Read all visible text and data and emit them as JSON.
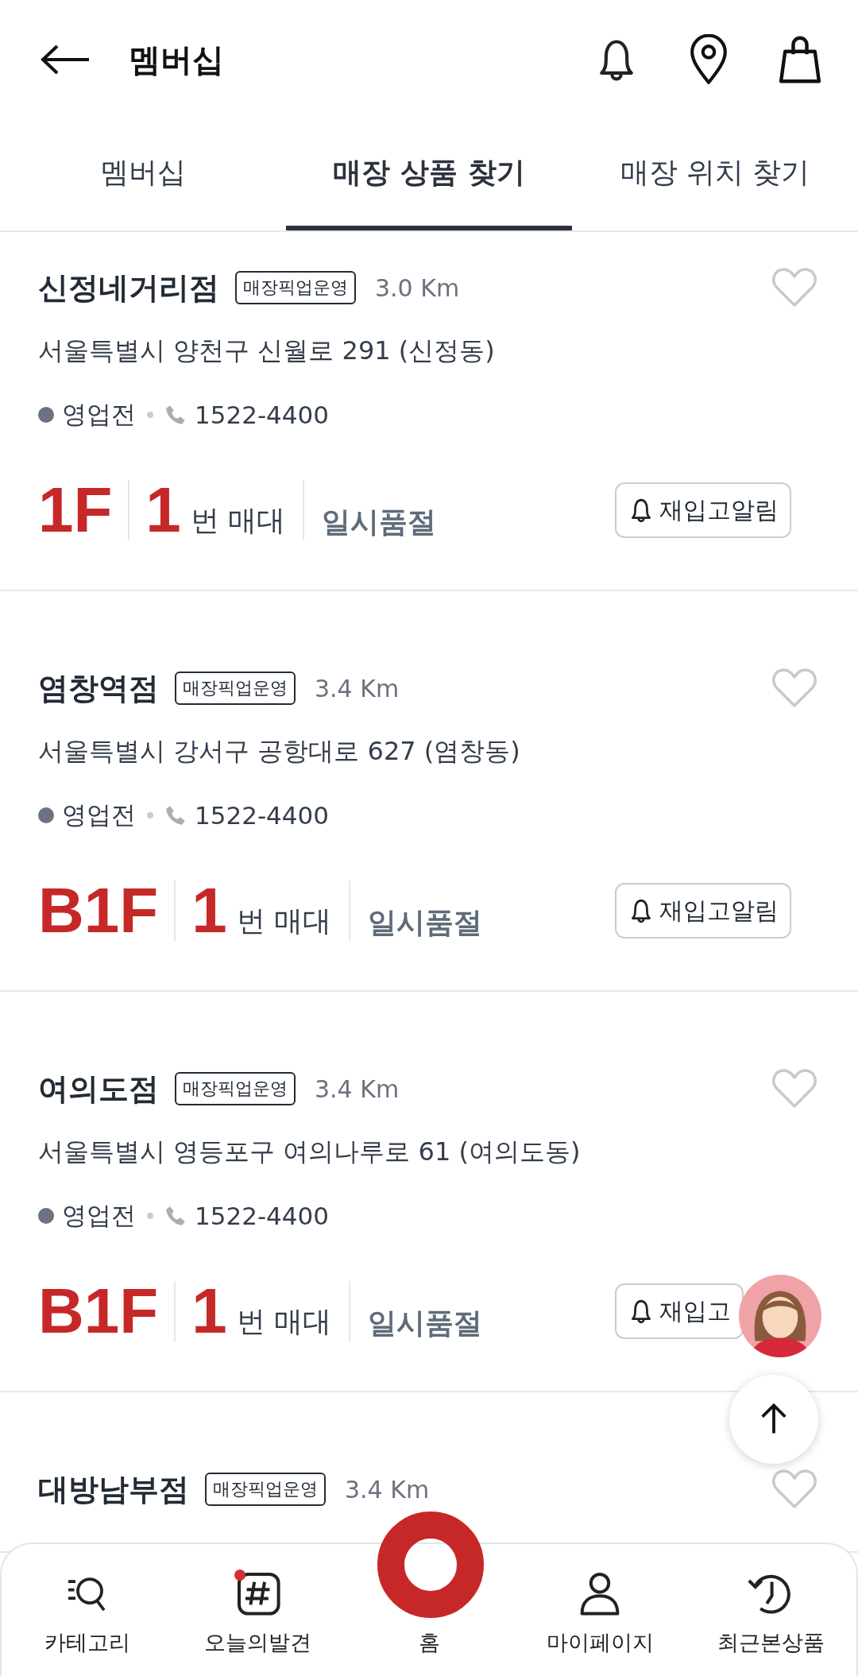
{
  "header": {
    "title": "멤버십"
  },
  "tabs": [
    {
      "label": "멤버십",
      "selected": false
    },
    {
      "label": "매장 상품 찾기",
      "selected": true
    },
    {
      "label": "매장 위치 찾기",
      "selected": false
    }
  ],
  "stores": [
    {
      "name": "신정네거리점",
      "badge": "매장픽업운영",
      "distance": "3.0 Km",
      "favorite": false,
      "address": "서울특별시 양천구 신월로 291 (신정동)",
      "status": "영업전",
      "phone": "1522-4400",
      "floor": "1F",
      "stand_number": "1",
      "stand_label": "번 매대",
      "stock_status": "일시품절",
      "restock_button": "재입고알림"
    },
    {
      "name": "염창역점",
      "badge": "매장픽업운영",
      "distance": "3.4 Km",
      "favorite": false,
      "address": "서울특별시 강서구 공항대로 627 (염창동)",
      "status": "영업전",
      "phone": "1522-4400",
      "floor": "B1F",
      "stand_number": "1",
      "stand_label": "번 매대",
      "stock_status": "일시품절",
      "restock_button": "재입고알림"
    },
    {
      "name": "여의도점",
      "badge": "매장픽업운영",
      "distance": "3.4 Km",
      "favorite": false,
      "address": "서울특별시 영등포구 여의나루로 61 (여의도동)",
      "status": "영업전",
      "phone": "1522-4400",
      "floor": "B1F",
      "stand_number": "1",
      "stand_label": "번 매대",
      "stock_status": "일시품절",
      "restock_button": "재입고"
    },
    {
      "name": "대방남부점",
      "badge": "매장픽업운영",
      "distance": "3.4 Km",
      "favorite": false
    }
  ],
  "bottom_nav": [
    {
      "label": "카테고리",
      "kind": "category"
    },
    {
      "label": "오늘의발견",
      "kind": "discover",
      "has_new": true
    },
    {
      "label": "홈",
      "kind": "home"
    },
    {
      "label": "마이페이지",
      "kind": "mypage"
    },
    {
      "label": "최근본상품",
      "kind": "recent"
    }
  ]
}
